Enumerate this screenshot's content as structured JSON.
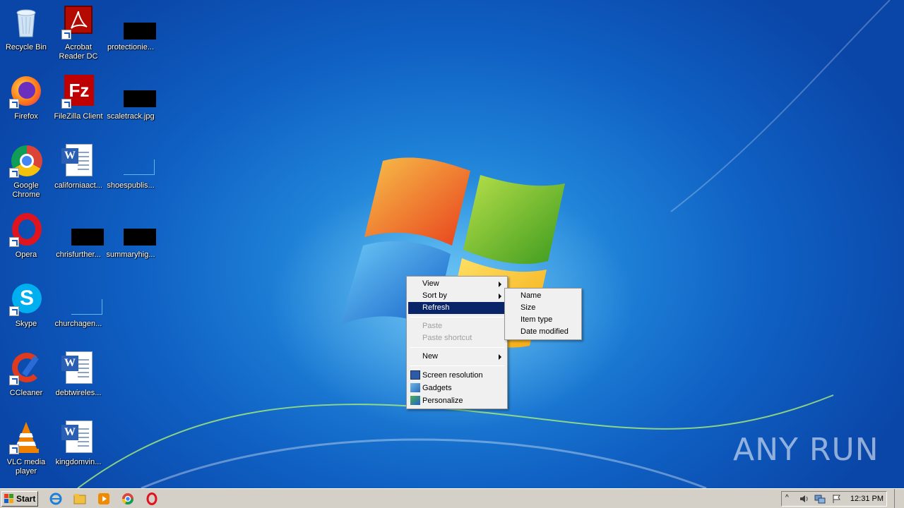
{
  "desktop": {
    "icons": [
      {
        "label": "Recycle Bin"
      },
      {
        "label": "Acrobat Reader DC"
      },
      {
        "label": "protectionie..."
      },
      {
        "label": "Firefox"
      },
      {
        "label": "FileZilla Client"
      },
      {
        "label": "scaletrack.jpg"
      },
      {
        "label": "Google Chrome"
      },
      {
        "label": "californiaact..."
      },
      {
        "label": "shoespublis..."
      },
      {
        "label": "Opera"
      },
      {
        "label": "chrisfurther..."
      },
      {
        "label": "summaryhig..."
      },
      {
        "label": "Skype"
      },
      {
        "label": "churchagen..."
      },
      {
        "label": "CCleaner"
      },
      {
        "label": "debtwireles..."
      },
      {
        "label": "VLC media player"
      },
      {
        "label": "kingdomvin..."
      }
    ]
  },
  "context_menu": {
    "items": [
      {
        "label": "View"
      },
      {
        "label": "Sort by"
      },
      {
        "label": "Refresh"
      },
      {
        "label": "Paste"
      },
      {
        "label": "Paste shortcut"
      },
      {
        "label": "New"
      },
      {
        "label": "Screen resolution"
      },
      {
        "label": "Gadgets"
      },
      {
        "label": "Personalize"
      }
    ],
    "highlighted": "Refresh"
  },
  "submenu": {
    "items": [
      {
        "label": "Name"
      },
      {
        "label": "Size"
      },
      {
        "label": "Item type"
      },
      {
        "label": "Date modified"
      }
    ]
  },
  "taskbar": {
    "start_label": "Start",
    "clock": "12:31 PM"
  },
  "watermark": "ANY RUN",
  "colors": {
    "highlight": "#0a246a",
    "taskbar": "#d4d0c8"
  }
}
